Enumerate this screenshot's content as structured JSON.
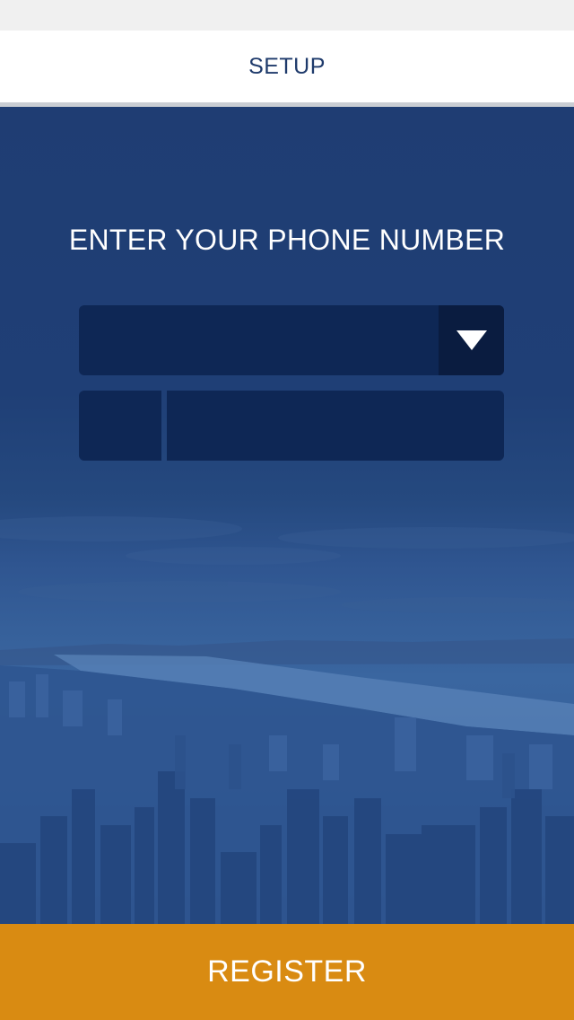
{
  "nav": {
    "title": "SETUP"
  },
  "form": {
    "prompt": "ENTER YOUR PHONE NUMBER",
    "country_select": {
      "value": ""
    },
    "country_code": {
      "value": ""
    },
    "phone_number": {
      "value": ""
    }
  },
  "actions": {
    "register_label": "REGISTER"
  },
  "icons": {
    "dropdown": "triangle-down-icon"
  },
  "colors": {
    "nav_text": "#1e3a6b",
    "hero_blue": "#1f3d73",
    "field_bg": "#0e2755",
    "dropdown_bg": "#0a1c40",
    "register_bg": "#d98b12",
    "text_light": "#ffffff"
  }
}
